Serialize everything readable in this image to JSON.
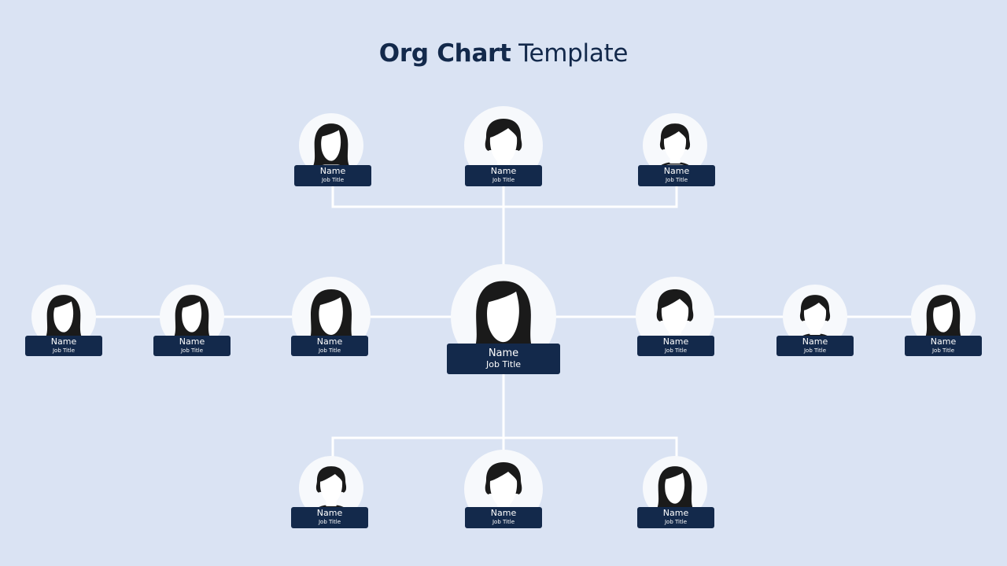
{
  "title": {
    "bold": "Org Chart",
    "regular": "Template"
  },
  "colors": {
    "background": "#dae3f3",
    "navy": "#13294b",
    "circle": "#f7f9fc",
    "line": "#ffffff"
  },
  "nodes": {
    "top_left": {
      "name": "Name",
      "job_title": "Job Title",
      "avatar": "female-avatar"
    },
    "top_center": {
      "name": "Name",
      "job_title": "Job Title",
      "avatar": "male-avatar"
    },
    "top_right": {
      "name": "Name",
      "job_title": "Job Title",
      "avatar": "male-avatar"
    },
    "mid_1": {
      "name": "Name",
      "job_title": "Job Title",
      "avatar": "female-avatar"
    },
    "mid_2": {
      "name": "Name",
      "job_title": "Job Title",
      "avatar": "female-avatar"
    },
    "mid_3": {
      "name": "Name",
      "job_title": "Job Title",
      "avatar": "female-avatar"
    },
    "center": {
      "name": "Name",
      "job_title": "Job Title",
      "avatar": "female-avatar"
    },
    "mid_5": {
      "name": "Name",
      "job_title": "Job Title",
      "avatar": "male-avatar"
    },
    "mid_6": {
      "name": "Name",
      "job_title": "Job Title",
      "avatar": "male-avatar"
    },
    "mid_7": {
      "name": "Name",
      "job_title": "Job Title",
      "avatar": "female-avatar"
    },
    "bottom_left": {
      "name": "Name",
      "job_title": "Job Title",
      "avatar": "male-avatar"
    },
    "bottom_center": {
      "name": "Name",
      "job_title": "Job Title",
      "avatar": "male-avatar"
    },
    "bottom_right": {
      "name": "Name",
      "job_title": "Job Title",
      "avatar": "female-avatar"
    }
  }
}
